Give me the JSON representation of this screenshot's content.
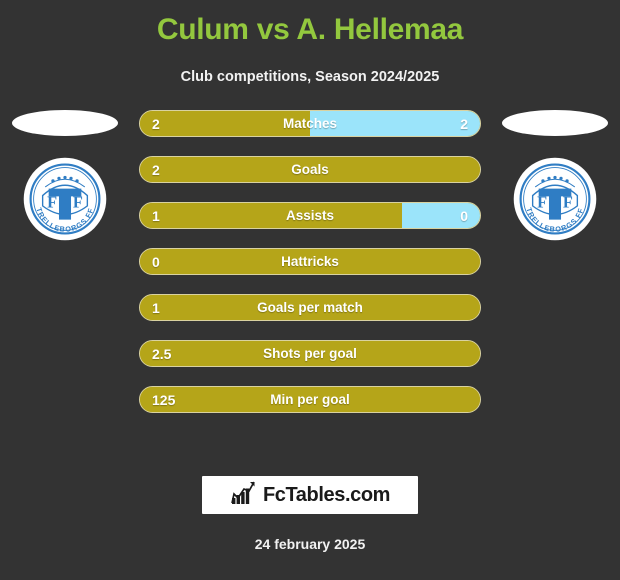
{
  "header": {
    "title": "Culum vs A. Hellemaa",
    "subtitle": "Club competitions, Season 2024/2025",
    "title_color": "#93c83e"
  },
  "home": {
    "club_name": "TRELLEBORGS FF",
    "crest_letters": "F T F"
  },
  "away": {
    "club_name": "TRELLEBORGS FF",
    "crest_letters": "F T F"
  },
  "colors": {
    "background": "#333333",
    "home_bar": "#b5a519",
    "away_bar": "#9be4fa",
    "bar_border": "#d9d2a0",
    "text": "#ffffff"
  },
  "stats": [
    {
      "label": "Matches",
      "home": "2",
      "away": "2",
      "home_pct": 50
    },
    {
      "label": "Goals",
      "home": "2",
      "away": "",
      "home_pct": 100
    },
    {
      "label": "Assists",
      "home": "1",
      "away": "0",
      "home_pct": 77
    },
    {
      "label": "Hattricks",
      "home": "0",
      "away": "",
      "home_pct": 100
    },
    {
      "label": "Goals per match",
      "home": "1",
      "away": "",
      "home_pct": 100
    },
    {
      "label": "Shots per goal",
      "home": "2.5",
      "away": "",
      "home_pct": 100
    },
    {
      "label": "Min per goal",
      "home": "125",
      "away": "",
      "home_pct": 100
    }
  ],
  "footer": {
    "brand": "FcTables.com",
    "brand_icon": "bar-chart-arrow-icon",
    "date": "24 february 2025"
  }
}
